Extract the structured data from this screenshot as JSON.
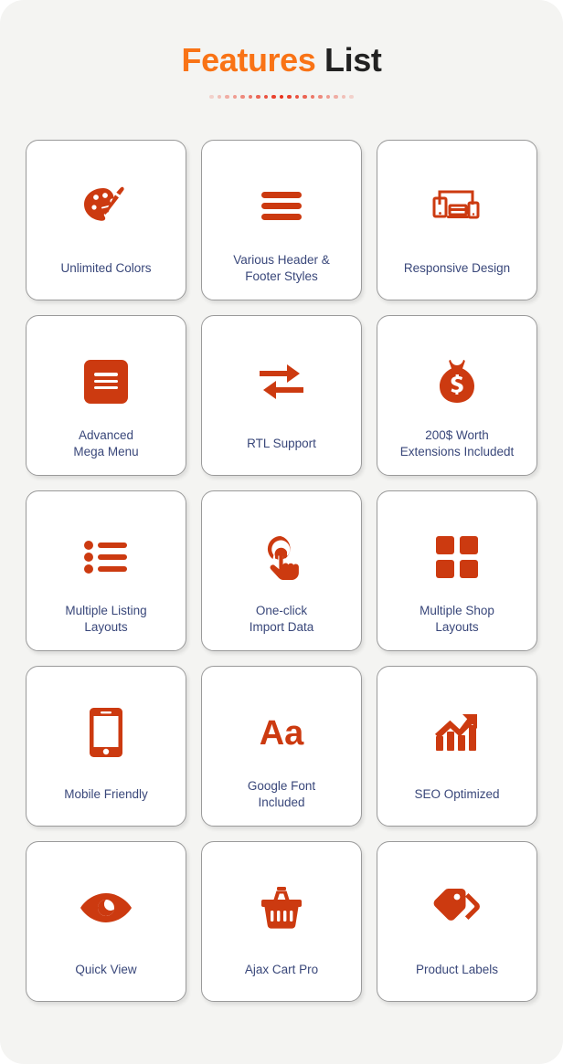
{
  "header": {
    "title_accent": "Features",
    "title_plain": "List",
    "divider_dot_count": 19,
    "accent_color": "#f97316",
    "plain_color": "#222222",
    "dot_color": "#e8301a"
  },
  "theme": {
    "page_background": "#f4f4f2",
    "card_background": "#ffffff",
    "card_border": "#9a9a9a",
    "icon_color": "#cc3a10",
    "label_color": "#39477a"
  },
  "features": [
    {
      "label": "Unlimited Colors",
      "icon": "palette-icon",
      "lines": 1
    },
    {
      "label": "Various Header &\nFooter Styles",
      "icon": "hamburger-menu-icon",
      "lines": 2
    },
    {
      "label": "Responsive Design",
      "icon": "responsive-devices-icon",
      "lines": 1
    },
    {
      "label": "Advanced\nMega Menu",
      "icon": "mega-menu-icon",
      "lines": 2
    },
    {
      "label": "RTL Support",
      "icon": "swap-arrows-icon",
      "lines": 1
    },
    {
      "label": "200$ Worth\nExtensions Includedt",
      "icon": "money-bag-icon",
      "lines": 2
    },
    {
      "label": "Multiple Listing\nLayouts",
      "icon": "bullet-list-icon",
      "lines": 2
    },
    {
      "label": "One-click\nImport Data",
      "icon": "click-hand-icon",
      "lines": 2
    },
    {
      "label": "Multiple Shop\nLayouts",
      "icon": "grid-squares-icon",
      "lines": 2
    },
    {
      "label": "Mobile Friendly",
      "icon": "mobile-phone-icon",
      "lines": 1
    },
    {
      "label": "Google Font\nIncluded",
      "icon": "font-aa-icon",
      "lines": 2
    },
    {
      "label": "SEO Optimized",
      "icon": "growth-chart-icon",
      "lines": 1
    },
    {
      "label": "Quick View",
      "icon": "eye-icon",
      "lines": 1
    },
    {
      "label": "Ajax Cart Pro",
      "icon": "shopping-basket-icon",
      "lines": 1
    },
    {
      "label": "Product Labels",
      "icon": "price-tags-icon",
      "lines": 1
    }
  ]
}
